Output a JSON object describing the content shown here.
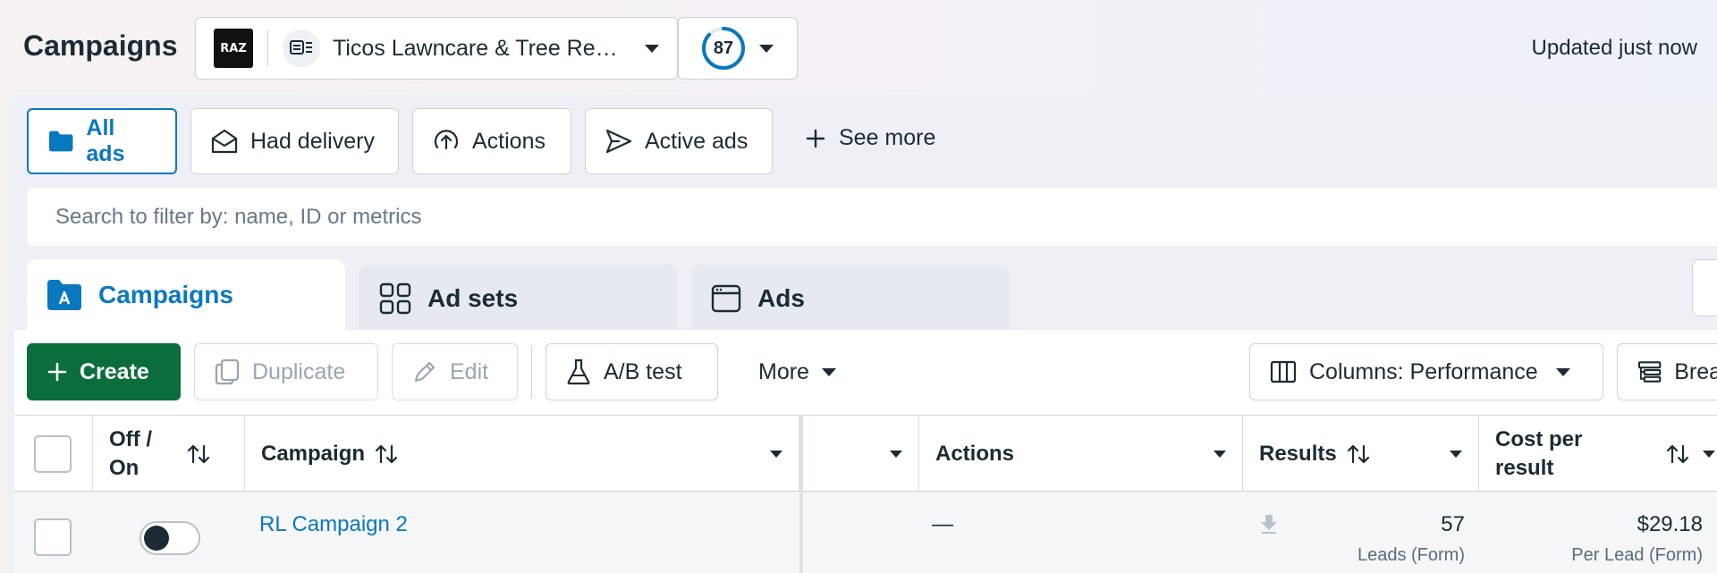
{
  "header": {
    "title": "Campaigns",
    "account_logo_text": "RAZ",
    "account_name": "Ticos Lawncare & Tree Re…",
    "opportunity_score": "87",
    "updated_text": "Updated just now",
    "score_color": "#0a78be"
  },
  "filters": {
    "chips": [
      {
        "label": "All ads",
        "icon": "folder-icon",
        "active": true
      },
      {
        "label": "Had delivery",
        "icon": "envelope-open-icon"
      },
      {
        "label": "Actions",
        "icon": "arrow-up-circle-icon"
      },
      {
        "label": "Active ads",
        "icon": "send-icon"
      }
    ],
    "see_more_label": "See more",
    "search_placeholder": "Search to filter by: name, ID or metrics"
  },
  "level_tabs": [
    {
      "label": "Campaigns",
      "icon": "campaign-folder-icon",
      "active": true
    },
    {
      "label": "Ad sets",
      "icon": "grid-icon"
    },
    {
      "label": "Ads",
      "icon": "ad-window-icon"
    }
  ],
  "toolbar": {
    "create_label": "Create",
    "duplicate_label": "Duplicate",
    "edit_label": "Edit",
    "ab_test_label": "A/B test",
    "more_label": "More",
    "columns_label": "Columns: Performance",
    "breakdown_label": "Brea",
    "create_color": "#0b6d3b"
  },
  "table": {
    "headers": {
      "off_on": "Off / On",
      "campaign": "Campaign",
      "actions": "Actions",
      "results": "Results",
      "cost_per_result": "Cost per result"
    },
    "rows": [
      {
        "campaign": "RL Campaign 2",
        "on": false,
        "actions": "—",
        "results": "57",
        "results_sub": "Leads (Form)",
        "cost_per_result": "$29.18",
        "cost_sub": "Per Lead (Form)"
      }
    ],
    "link_color": "#0a78be"
  }
}
